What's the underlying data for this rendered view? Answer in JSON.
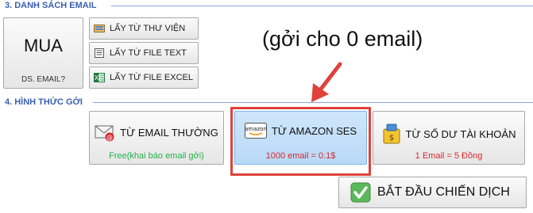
{
  "sections": {
    "email_list_title": "3. DANH SÁCH EMAIL",
    "send_method_title": "4. HÌNH THỨC GỞI"
  },
  "buy_button": {
    "main_label": "MUA",
    "sub_label": "DS. EMAIL?"
  },
  "source_buttons": [
    {
      "label": "LẤY TỪ THƯ VIỆN",
      "icon": "library-icon"
    },
    {
      "label": "LẤY TỪ FILE TEXT",
      "icon": "text-file-icon"
    },
    {
      "label": "LẤY TỪ FILE EXCEL",
      "icon": "excel-file-icon"
    }
  ],
  "overlay": {
    "note": "(gởi cho 0 email)"
  },
  "methods": [
    {
      "label": "TỪ EMAIL THƯỜNG",
      "sub": "Free(khai báo email gởi)",
      "icon": "email-icon",
      "sub_color": "#22b14c"
    },
    {
      "label": "TỪ AMAZON SES",
      "sub": "1000 email = 0.1$",
      "icon": "amazon-icon",
      "sub_color": "#d9262e",
      "selected": true
    },
    {
      "label": "TỪ SỐ DƯ TÀI KHOẢN",
      "sub": "1 Email = 5 Đồng",
      "icon": "wallet-icon",
      "sub_color": "#d9262e"
    }
  ],
  "start_button": {
    "label": "BẮT ĐẦU CHIẾN DỊCH",
    "icon": "check-icon"
  },
  "colors": {
    "section_title": "#3a5fb0",
    "highlight": "#e0413a",
    "selected_bg": "#b8d9f6"
  }
}
